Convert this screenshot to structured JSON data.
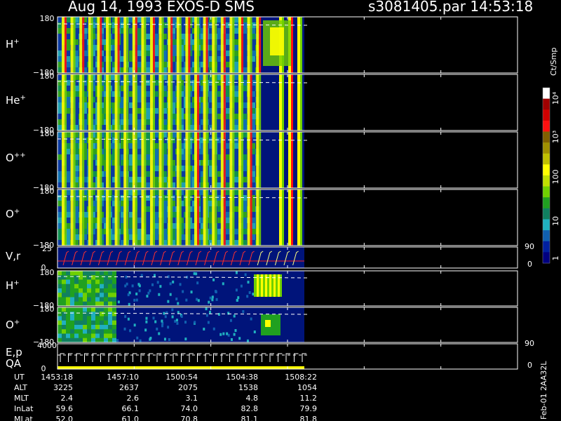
{
  "header": {
    "left": "Aug 14, 1993    EXOS-D SMS",
    "right": "s3081405.par  14:53:18"
  },
  "panels": [
    {
      "id": "H+ pitch",
      "label": "H",
      "sup": "+",
      "top": "180",
      "bottom": "−180"
    },
    {
      "id": "He+ pitch",
      "label": "He",
      "sup": "+",
      "top": "180",
      "bottom": "−180"
    },
    {
      "id": "O++ pitch",
      "label": "O",
      "sup": "++",
      "top": "180",
      "bottom": "−180"
    },
    {
      "id": "O+ pitch",
      "label": "O",
      "sup": "+",
      "top": "180",
      "bottom": "−180"
    },
    {
      "id": "V,r",
      "label": "V,r",
      "sup": "",
      "top": "25",
      "bottom": "0",
      "right_top": "90",
      "right_bottom": "0"
    },
    {
      "id": "H+ low",
      "label": "H",
      "sup": "+",
      "top": "180",
      "bottom": "−180"
    },
    {
      "id": "O+ low",
      "label": "O",
      "sup": "+",
      "top": "180",
      "bottom": "−180"
    },
    {
      "id": "E,p QA",
      "label": "E,p",
      "label2": "QA",
      "sup": "",
      "top": "4000",
      "bottom": "0",
      "right_top": "90",
      "right_bottom": "0"
    }
  ],
  "colorbar": {
    "unit": "Ct/Smp",
    "ticks": [
      "10⁴",
      "10³",
      "100",
      "10",
      "1"
    ],
    "colors": [
      "#ffffff",
      "#a00000",
      "#d00000",
      "#ff1010",
      "#806000",
      "#a09000",
      "#c0c000",
      "#ffff00",
      "#c0e000",
      "#70d000",
      "#20a020",
      "#108060",
      "#20b0c0",
      "#1060b0",
      "#0020a0",
      "#000080"
    ]
  },
  "footer": {
    "rows": [
      {
        "label": "UT",
        "values": [
          "1453:18",
          "1457:10",
          "1500:54",
          "1504:38",
          "1508:22"
        ]
      },
      {
        "label": "ALT",
        "values": [
          "3225",
          "2637",
          "2075",
          "1538",
          "1054"
        ]
      },
      {
        "label": "MLT",
        "values": [
          "2.4",
          "2.6",
          "3.1",
          "4.8",
          "11.2"
        ]
      },
      {
        "label": "InLat",
        "values": [
          "59.6",
          "66.1",
          "74.0",
          "82.8",
          "79.9"
        ]
      },
      {
        "label": "MLat",
        "values": [
          "52.0",
          "61.0",
          "70.8",
          "81.1",
          "81.8"
        ]
      }
    ],
    "side_text": "Feb-01 2AA32L"
  },
  "chart_data": {
    "type": "heatmap",
    "x": [
      "1453:18",
      "1457:10",
      "1500:54",
      "1504:38",
      "1508:22"
    ],
    "colorbar_unit": "Ct/Smp",
    "colorbar_ticks": [
      "1",
      "10",
      "100",
      "10³",
      "10⁴"
    ],
    "panels": [
      "H+",
      "He+",
      "O++",
      "O+",
      "V,r",
      "H+",
      "O+",
      "E,p QA"
    ]
  }
}
